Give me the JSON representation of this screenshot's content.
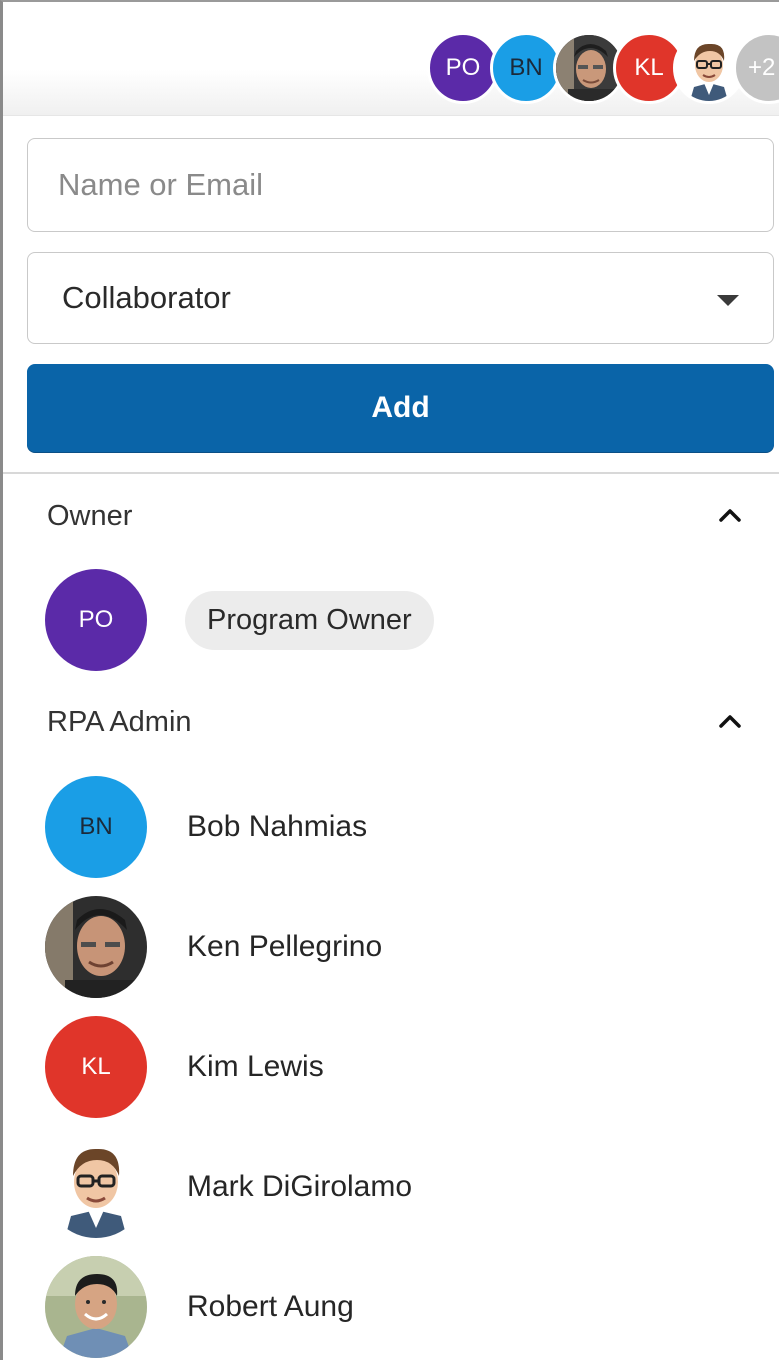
{
  "header": {
    "avatars": [
      {
        "kind": "initials",
        "initials": "PO",
        "color": "#5b2aa8"
      },
      {
        "kind": "initials",
        "initials": "BN",
        "color": "#1a9ee6"
      },
      {
        "kind": "photo",
        "icon": "person-photo-icon"
      },
      {
        "kind": "initials",
        "initials": "KL",
        "color": "#e0352a"
      },
      {
        "kind": "illustration",
        "icon": "cartoon-person-icon"
      },
      {
        "kind": "overflow",
        "label": "+2"
      }
    ]
  },
  "form": {
    "name_placeholder": "Name or Email",
    "name_value": "",
    "role_value": "Collaborator",
    "add_label": "Add",
    "accent_color": "#0a64a8"
  },
  "sections": {
    "owner": {
      "title": "Owner",
      "members": [
        {
          "initials": "PO",
          "name": "Program Owner",
          "color": "#5b2aa8"
        }
      ]
    },
    "rpa_admin": {
      "title": "RPA Admin",
      "members": [
        {
          "initials": "BN",
          "name": "Bob Nahmias",
          "color": "#1a9ee6"
        },
        {
          "avatar": "person-photo-icon",
          "name": "Ken Pellegrino"
        },
        {
          "initials": "KL",
          "name": "Kim Lewis",
          "color": "#e0352a"
        },
        {
          "avatar": "cartoon-person-icon",
          "name": "Mark DiGirolamo"
        },
        {
          "avatar": "person-photo-icon",
          "name": "Robert Aung"
        }
      ]
    }
  }
}
